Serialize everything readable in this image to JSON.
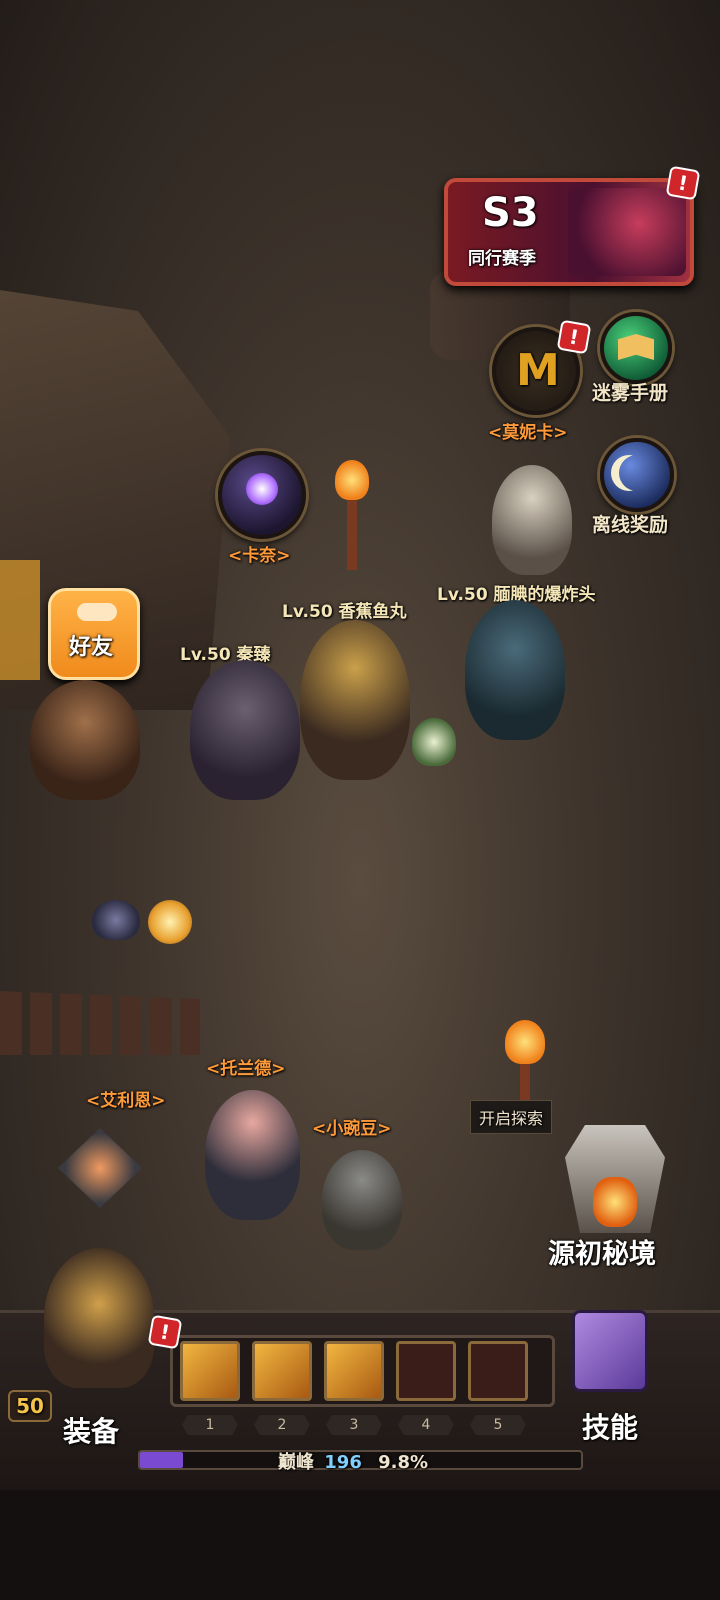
{
  "season": {
    "code": "S3",
    "label": "同行赛季",
    "badge": "!"
  },
  "top_right": {
    "manual_label": "迷雾手册",
    "offline_reward_label": "离线奖励",
    "npc_monica": "<莫妮卡>",
    "monica_badge": "!"
  },
  "friends_button": {
    "label": "好友"
  },
  "npcs": {
    "kana": "<卡奈>",
    "tolande": "<托兰德>",
    "ellien": "<艾利恩>",
    "pea": "<小豌豆>"
  },
  "players": [
    {
      "level_name": "Lv.50 香蕉鱼丸"
    },
    {
      "level_name": "Lv.50 秦臻"
    },
    {
      "level_name": "Lv.50 腼腆的爆炸头"
    }
  ],
  "explore": {
    "tooltip": "开启探索",
    "label": "源初秘境"
  },
  "bottom_bar": {
    "equip_label": "装备",
    "equip_badge": "!",
    "skill_label": "技能",
    "player_level": "50",
    "slots": [
      "1",
      "2",
      "3",
      "4",
      "5"
    ],
    "peak_label": "巅峰",
    "peak_value": "196",
    "peak_percent": "9.8%",
    "peak_progress": 0.098
  },
  "colors": {
    "npc_name": "#ff9a3a",
    "season_bg": "#7a1a22",
    "friends_btn": "#f39a2c",
    "xp_fill": "#7a4bd0"
  }
}
